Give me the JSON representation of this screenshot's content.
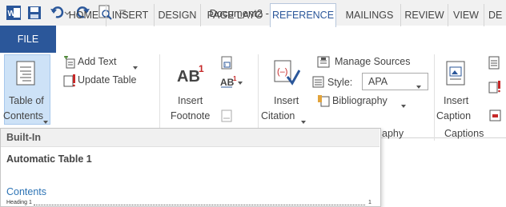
{
  "window": {
    "title": "Document2 - Word"
  },
  "qat": {
    "icons": [
      "word-app-icon",
      "save-icon",
      "undo-icon",
      "redo-icon",
      "print-preview-icon",
      "customize-qat-icon"
    ]
  },
  "tabs": [
    {
      "label": "FILE"
    },
    {
      "label": "HOME"
    },
    {
      "label": "INSERT"
    },
    {
      "label": "DESIGN"
    },
    {
      "label": "PAGE LAYO"
    },
    {
      "label": "REFERENCE"
    },
    {
      "label": "MAILINGS"
    },
    {
      "label": "REVIEW"
    },
    {
      "label": "VIEW"
    },
    {
      "label": "DE"
    }
  ],
  "ribbon": {
    "toc": {
      "line1": "Table of",
      "line2": "Contents",
      "add_text": "Add Text",
      "update_table": "Update Table"
    },
    "footnote": {
      "line1": "Insert",
      "line2": "Footnote"
    },
    "citation": {
      "line1": "Insert",
      "line2": "Citation",
      "manage_sources": "Manage Sources",
      "style_label": "Style:",
      "style_value": "APA",
      "bibliography": "Bibliography",
      "group_fragment": "aphy"
    },
    "captions": {
      "line1": "Insert",
      "line2": "Caption",
      "group": "Captions"
    }
  },
  "dropdown": {
    "header": "Built-In",
    "item_title": "Automatic Table 1",
    "preview_heading": "Contents",
    "preview_entry": "Heading 1",
    "preview_page": "1"
  },
  "colors": {
    "accent": "#2b579a",
    "word_blue": "#2b579a",
    "link_blue": "#2e74b5"
  }
}
